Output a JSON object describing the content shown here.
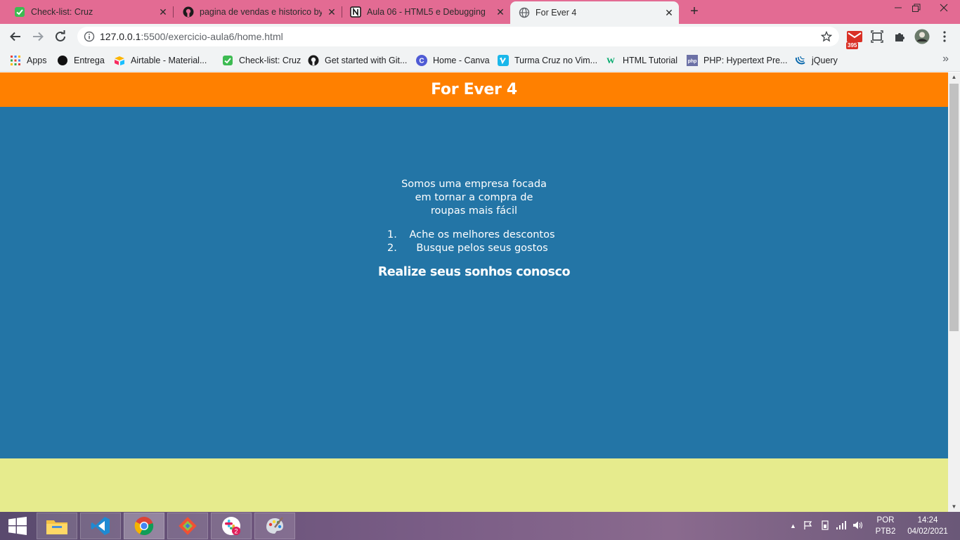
{
  "browser": {
    "tabs": [
      {
        "title": "Check-list: Cruz",
        "icon": "green-check-icon"
      },
      {
        "title": "pagina de vendas e historico by",
        "icon": "github-icon"
      },
      {
        "title": "Aula 06 - HTML5 e Debugging",
        "icon": "notion-icon"
      },
      {
        "title": "For Ever 4",
        "icon": "globe-icon",
        "active": true
      }
    ],
    "address": {
      "host": "127.0.0.1",
      "rest": ":5500/exercicio-aula6/home.html"
    },
    "gmail_badge": "395",
    "bookmarks": [
      {
        "label": "Apps",
        "icon": "apps-grid-icon"
      },
      {
        "label": "Entrega",
        "icon": "black-circle-icon"
      },
      {
        "label": "Airtable - Material...",
        "icon": "airtable-icon"
      },
      {
        "label": "Check-list: Cruz",
        "icon": "green-check-icon"
      },
      {
        "label": "Get started with Git...",
        "icon": "github-icon"
      },
      {
        "label": "Home - Canva",
        "icon": "canva-icon"
      },
      {
        "label": "Turma Cruz no Vim...",
        "icon": "vimeo-icon"
      },
      {
        "label": "HTML Tutorial",
        "icon": "w3schools-icon"
      },
      {
        "label": "PHP: Hypertext Pre...",
        "icon": "php-icon"
      },
      {
        "label": "jQuery",
        "icon": "jquery-icon"
      }
    ]
  },
  "page": {
    "header_title": "For Ever 4",
    "intro_lines": [
      "Somos uma empresa focada",
      "em tornar a compra de",
      "roupas mais fácil"
    ],
    "steps": [
      {
        "num": "1.",
        "text": "Ache os melhores descontos"
      },
      {
        "num": "2.",
        "text": "Busque pelos seus gostos"
      }
    ],
    "slogan": "Realize seus sonhos conosco"
  },
  "taskbar": {
    "apps": [
      "file-explorer-icon",
      "vscode-icon",
      "chrome-icon",
      "git-icon",
      "slack-icon",
      "paint-icon"
    ],
    "slack_badge": "2",
    "lang_top": "POR",
    "lang_bottom": "PTB2",
    "time": "14:24",
    "date": "04/02/2021"
  },
  "colors": {
    "tabstrip": "#e36b93",
    "header": "#ff8000",
    "main": "#2375a6",
    "footer": "#e6eb8d"
  }
}
